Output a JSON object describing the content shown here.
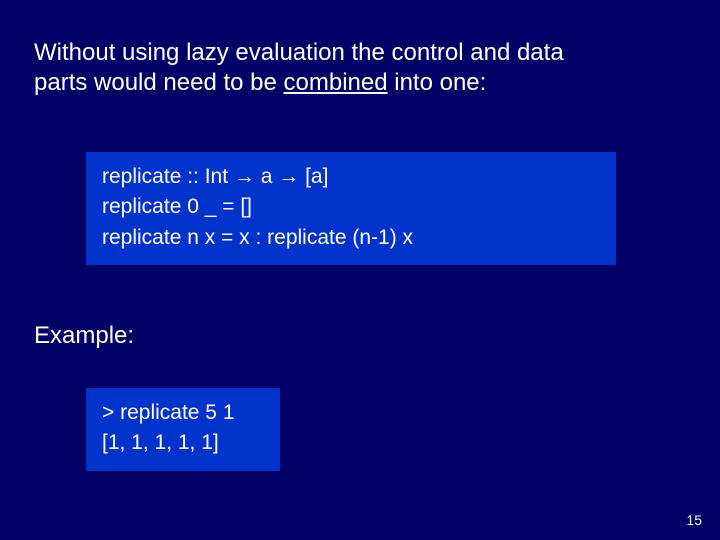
{
  "heading": {
    "line1_prefix": "Without using lazy evaluation the control and data",
    "line2_prefix": "parts would need to be ",
    "underlined": "combined",
    "line2_suffix": " into one:"
  },
  "code1": {
    "line1": "replicate :: Int → a → [a]",
    "line2": "replicate 0 _ = []",
    "line3": "replicate n x = x : replicate (n-1) x"
  },
  "example_label": "Example:",
  "code2": {
    "line1": "> replicate 5 1",
    "line2": "[1, 1, 1, 1, 1]"
  },
  "page_number": "15"
}
